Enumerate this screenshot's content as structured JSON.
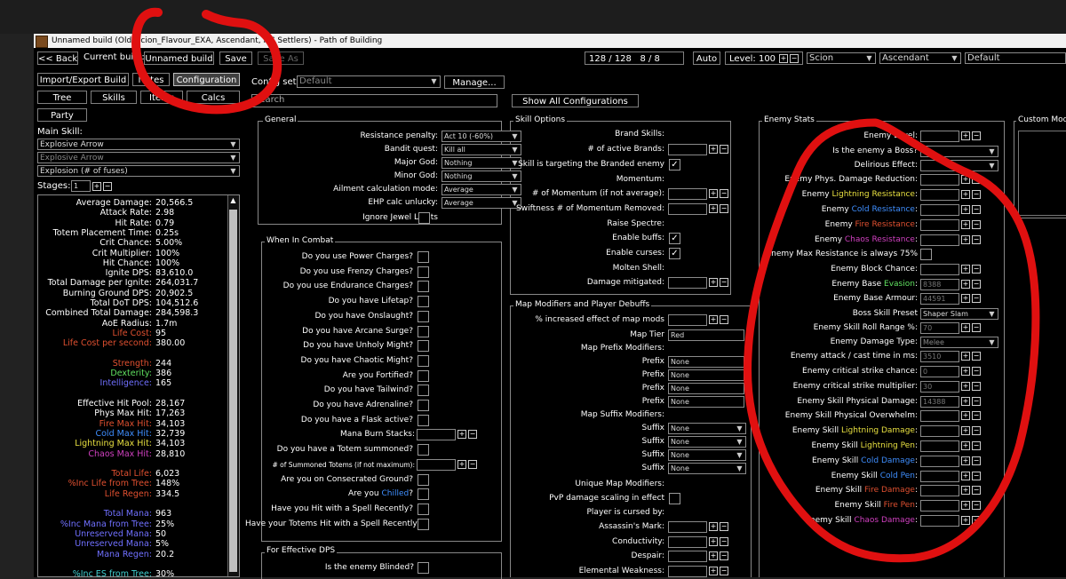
{
  "window": {
    "title": "Unnamed build (Old_Scion_Flavour_EXA, Ascendant, HC Settlers) - Path of Building"
  },
  "toolbar": {
    "back": "<< Back",
    "current_build_label": "Current build:",
    "build_name": "Unnamed build",
    "save": "Save",
    "save_as": "Save As",
    "points1": "128 / 128",
    "points2": "8 / 8",
    "auto": "Auto",
    "level_label": "Level:",
    "level_value": "100",
    "class": "Scion",
    "ascendancy": "Ascendant",
    "config_default": "Default"
  },
  "nav": {
    "import_export": "Import/Export Build",
    "notes": "Notes",
    "configuration": "Configuration",
    "tree": "Tree",
    "skills": "Skills",
    "items": "Items",
    "calcs": "Calcs",
    "party": "Party"
  },
  "main_skill": {
    "label": "Main Skill:",
    "skill": "Explosive Arrow",
    "sub_skill": "Explosive Arrow",
    "mode": "Explosion (# of fuses)",
    "stages_label": "Stages:",
    "stages_value": "1"
  },
  "stats": [
    {
      "k": "Average Damage:",
      "v": "20,566.5",
      "c": "#ffffff"
    },
    {
      "k": "Attack Rate:",
      "v": "2.98",
      "c": "#ffffff"
    },
    {
      "k": "Hit Rate:",
      "v": "0.79",
      "c": "#ffffff"
    },
    {
      "k": "Totem Placement Time:",
      "v": "0.25s",
      "c": "#ffffff"
    },
    {
      "k": "Crit Chance:",
      "v": "5.00%",
      "c": "#ffffff"
    },
    {
      "k": "Crit Multiplier:",
      "v": "100%",
      "c": "#ffffff"
    },
    {
      "k": "Hit Chance:",
      "v": "100%",
      "c": "#ffffff"
    },
    {
      "k": "Ignite DPS:",
      "v": "83,610.0",
      "c": "#ffffff"
    },
    {
      "k": "Total Damage per Ignite:",
      "v": "264,031.7",
      "c": "#ffffff"
    },
    {
      "k": "Burning Ground DPS:",
      "v": "20,902.5",
      "c": "#ffffff"
    },
    {
      "k": "Total DoT DPS:",
      "v": "104,512.6",
      "c": "#ffffff"
    },
    {
      "k": "Combined Total Damage:",
      "v": "284,598.3",
      "c": "#ffffff"
    },
    {
      "k": "AoE Radius:",
      "v": "1.7m",
      "c": "#ffffff"
    },
    {
      "k": "Life Cost:",
      "v": "95",
      "c": "#e05030"
    },
    {
      "k": "Life Cost per second:",
      "v": "380.00",
      "c": "#e05030"
    },
    {
      "k": "",
      "v": "",
      "c": "#ffffff"
    },
    {
      "k": "Strength:",
      "v": "244",
      "c": "#e05030"
    },
    {
      "k": "Dexterity:",
      "v": "386",
      "c": "#60e060"
    },
    {
      "k": "Intelligence:",
      "v": "165",
      "c": "#7070ff"
    },
    {
      "k": "",
      "v": "",
      "c": "#ffffff"
    },
    {
      "k": "Effective Hit Pool:",
      "v": "28,167",
      "c": "#ffffff"
    },
    {
      "k": "Phys Max Hit:",
      "v": "17,263",
      "c": "#ffffff"
    },
    {
      "k": "Fire Max Hit:",
      "v": "34,103",
      "c": "#e05030"
    },
    {
      "k": "Cold Max Hit:",
      "v": "32,739",
      "c": "#3f8fff"
    },
    {
      "k": "Lightning Max Hit:",
      "v": "34,103",
      "c": "#e8e040"
    },
    {
      "k": "Chaos Max Hit:",
      "v": "28,810",
      "c": "#d040c0"
    },
    {
      "k": "",
      "v": "",
      "c": "#ffffff"
    },
    {
      "k": "Total Life:",
      "v": "6,023",
      "c": "#e05030"
    },
    {
      "k": "%Inc Life from Tree:",
      "v": "148%",
      "c": "#e05030"
    },
    {
      "k": "Life Regen:",
      "v": "334.5",
      "c": "#e05030"
    },
    {
      "k": "",
      "v": "",
      "c": "#ffffff"
    },
    {
      "k": "Total Mana:",
      "v": "963",
      "c": "#7070ff"
    },
    {
      "k": "%Inc Mana from Tree:",
      "v": "25%",
      "c": "#7070ff"
    },
    {
      "k": "Unreserved Mana:",
      "v": "50",
      "c": "#7070ff"
    },
    {
      "k": "Unreserved Mana:",
      "v": "5%",
      "c": "#7070ff"
    },
    {
      "k": "Mana Regen:",
      "v": "20.2",
      "c": "#7070ff"
    },
    {
      "k": "",
      "v": "",
      "c": "#ffffff"
    },
    {
      "k": "%Inc ES from Tree:",
      "v": "30%",
      "c": "#40d0d0"
    }
  ],
  "config": {
    "config_set_label": "Config set:",
    "config_set_value": "Default",
    "manage": "Manage...",
    "search_placeholder": "Search",
    "show_all": "Show All Configurations"
  },
  "general": {
    "title": "General",
    "resistance_penalty": {
      "label": "Resistance penalty:",
      "value": "Act 10 (-60%)"
    },
    "bandit_quest": {
      "label": "Bandit quest:",
      "value": "Kill all"
    },
    "major_god": {
      "label": "Major God:",
      "value": "Nothing"
    },
    "minor_god": {
      "label": "Minor God:",
      "value": "Nothing"
    },
    "ailment_mode": {
      "label": "Ailment calculation mode:",
      "value": "Average"
    },
    "ehp_unlucky": {
      "label": "EHP calc unlucky:",
      "value": "Average"
    },
    "ignore_jewel": {
      "label": "Ignore Jewel Limits"
    }
  },
  "combat": {
    "title": "When In Combat",
    "items": [
      {
        "t": "Do you use Power Charges?",
        "type": "chk"
      },
      {
        "t": "Do you use Frenzy Charges?",
        "type": "chk"
      },
      {
        "t": "Do you use Endurance Charges?",
        "type": "chk"
      },
      {
        "t": "Do you have Lifetap?",
        "type": "chk"
      },
      {
        "t": "Do you have Onslaught?",
        "type": "chk"
      },
      {
        "t": "Do you have Arcane Surge?",
        "type": "chk"
      },
      {
        "t": "Do you have Unholy Might?",
        "type": "chk"
      },
      {
        "t": "Do you have Chaotic Might?",
        "type": "chk"
      },
      {
        "t": "Are you Fortified?",
        "type": "chk"
      },
      {
        "t": "Do you have Tailwind?",
        "type": "chk"
      },
      {
        "t": "Do you have Adrenaline?",
        "type": "chk"
      },
      {
        "t": "Do you have a Flask active?",
        "type": "chk"
      },
      {
        "t": "Mana Burn Stacks:",
        "type": "num"
      },
      {
        "t": "Do you have a Totem summoned?",
        "type": "chk"
      },
      {
        "t": "# of Summoned Totems (if not maximum):",
        "type": "num"
      },
      {
        "t": "Are you on Consecrated Ground?",
        "type": "chk"
      },
      {
        "t": "Are you Chilled?",
        "type": "chk"
      },
      {
        "t": "Have you Hit with a Spell Recently?",
        "type": "chk"
      },
      {
        "t": "Have your Totems Hit with a Spell Recently?",
        "type": "chk"
      }
    ],
    "chilled_prefix": "Are you ",
    "chilled_word": "Chilled",
    "chilled_suffix": "?"
  },
  "effective_dps": {
    "title": "For Effective DPS",
    "blinded": "Is the enemy Blinded?"
  },
  "skill_options": {
    "title": "Skill Options",
    "brand_skills": "Brand Skills:",
    "active_brands": "# of active Brands:",
    "targeting_branded": "Skill is targeting the Branded enemy",
    "momentum": "Momentum:",
    "momentum_count": "# of Momentum (if not average):",
    "swiftness": "Swiftness # of Momentum Removed:",
    "raise_spectre": "Raise Spectre:",
    "enable_buffs": "Enable buffs:",
    "enable_curses": "Enable curses:",
    "molten_shell": "Molten Shell:",
    "damage_mitigated": "Damage mitigated:"
  },
  "map_mods": {
    "title": "Map Modifiers and Player Debuffs",
    "increased_effect": "% increased effect of map mods",
    "map_tier": {
      "label": "Map Tier",
      "value": "Red"
    },
    "prefix_label": "Map Prefix Modifiers:",
    "prefix": "Prefix",
    "suffix_label": "Map Suffix Modifiers:",
    "suffix": "Suffix",
    "none": "None",
    "unique_map": "Unique Map Modifiers:",
    "pvp": "PvP damage scaling in effect",
    "cursed_by": "Player is cursed by:",
    "assassins_mark": "Assassin's Mark:",
    "conductivity": "Conductivity:",
    "despair": "Despair:",
    "elemental_weakness": "Elemental Weakness:"
  },
  "enemy_stats": {
    "title": "Enemy Stats",
    "level": "Enemy Level:",
    "is_boss": {
      "label": "Is the enemy a Boss?",
      "value": "No"
    },
    "delirious": "Delirious Effect:",
    "phys_dr": "Enemy Phys. Damage Reduction:",
    "lightning_res": {
      "pre": "Enemy ",
      "word": "Lightning Resistance",
      "post": ":"
    },
    "cold_res": {
      "pre": "Enemy ",
      "word": "Cold Resistance",
      "post": ":"
    },
    "fire_res": {
      "pre": "Enemy ",
      "word": "Fire Resistance",
      "post": ":"
    },
    "chaos_res": {
      "pre": "Enemy ",
      "word": "Chaos Resistance",
      "post": ":"
    },
    "max_res": "Enemy Max Resistance is always 75%",
    "block": "Enemy Block Chance:",
    "base_evasion": {
      "pre": "Enemy Base ",
      "word": "Evasion",
      "post": ":",
      "value": "8388"
    },
    "base_armour": {
      "label": "Enemy Base Armour:",
      "value": "44591"
    },
    "boss_preset": {
      "label": "Boss Skill Preset",
      "value": "Shaper Slam"
    },
    "roll_range": {
      "label": "Enemy Skill Roll Range %:",
      "value": "70"
    },
    "damage_type": {
      "label": "Enemy Damage Type:",
      "value": "Melee"
    },
    "attack_time": {
      "label": "Enemy attack / cast time in ms:",
      "value": "3510"
    },
    "crit_chance": {
      "label": "Enemy critical strike chance:",
      "value": "0"
    },
    "crit_multi": {
      "label": "Enemy critical strike multiplier:",
      "value": "30"
    },
    "phys_damage": {
      "label": "Enemy Skill Physical Damage:",
      "value": "14388"
    },
    "phys_overwhelm": "Enemy Skill Physical Overwhelm:",
    "lightning_dmg": {
      "pre": "Enemy Skill ",
      "word": "Lightning Damage",
      "post": ":"
    },
    "lightning_pen": {
      "pre": "Enemy Skill ",
      "word": "Lightning Pen",
      "post": ":"
    },
    "cold_dmg": {
      "pre": "Enemy Skill ",
      "word": "Cold Damage",
      "post": ":"
    },
    "cold_pen": {
      "pre": "Enemy Skill ",
      "word": "Cold Pen",
      "post": ":"
    },
    "fire_dmg": {
      "pre": "Enemy Skill ",
      "word": "Fire Damage",
      "post": ":"
    },
    "fire_pen": {
      "pre": "Enemy Skill ",
      "word": "Fire Pen",
      "post": ":"
    },
    "chaos_dmg": {
      "pre": "Enemy Skill ",
      "word": "Chaos Damage",
      "post": ":"
    }
  },
  "custom_mods": {
    "title": "Custom Modifiers"
  },
  "colors": {
    "fire": "#e05030",
    "cold": "#3f8fff",
    "lightning": "#e8e040",
    "chaos": "#d040c0",
    "annotation": "#e01010"
  }
}
